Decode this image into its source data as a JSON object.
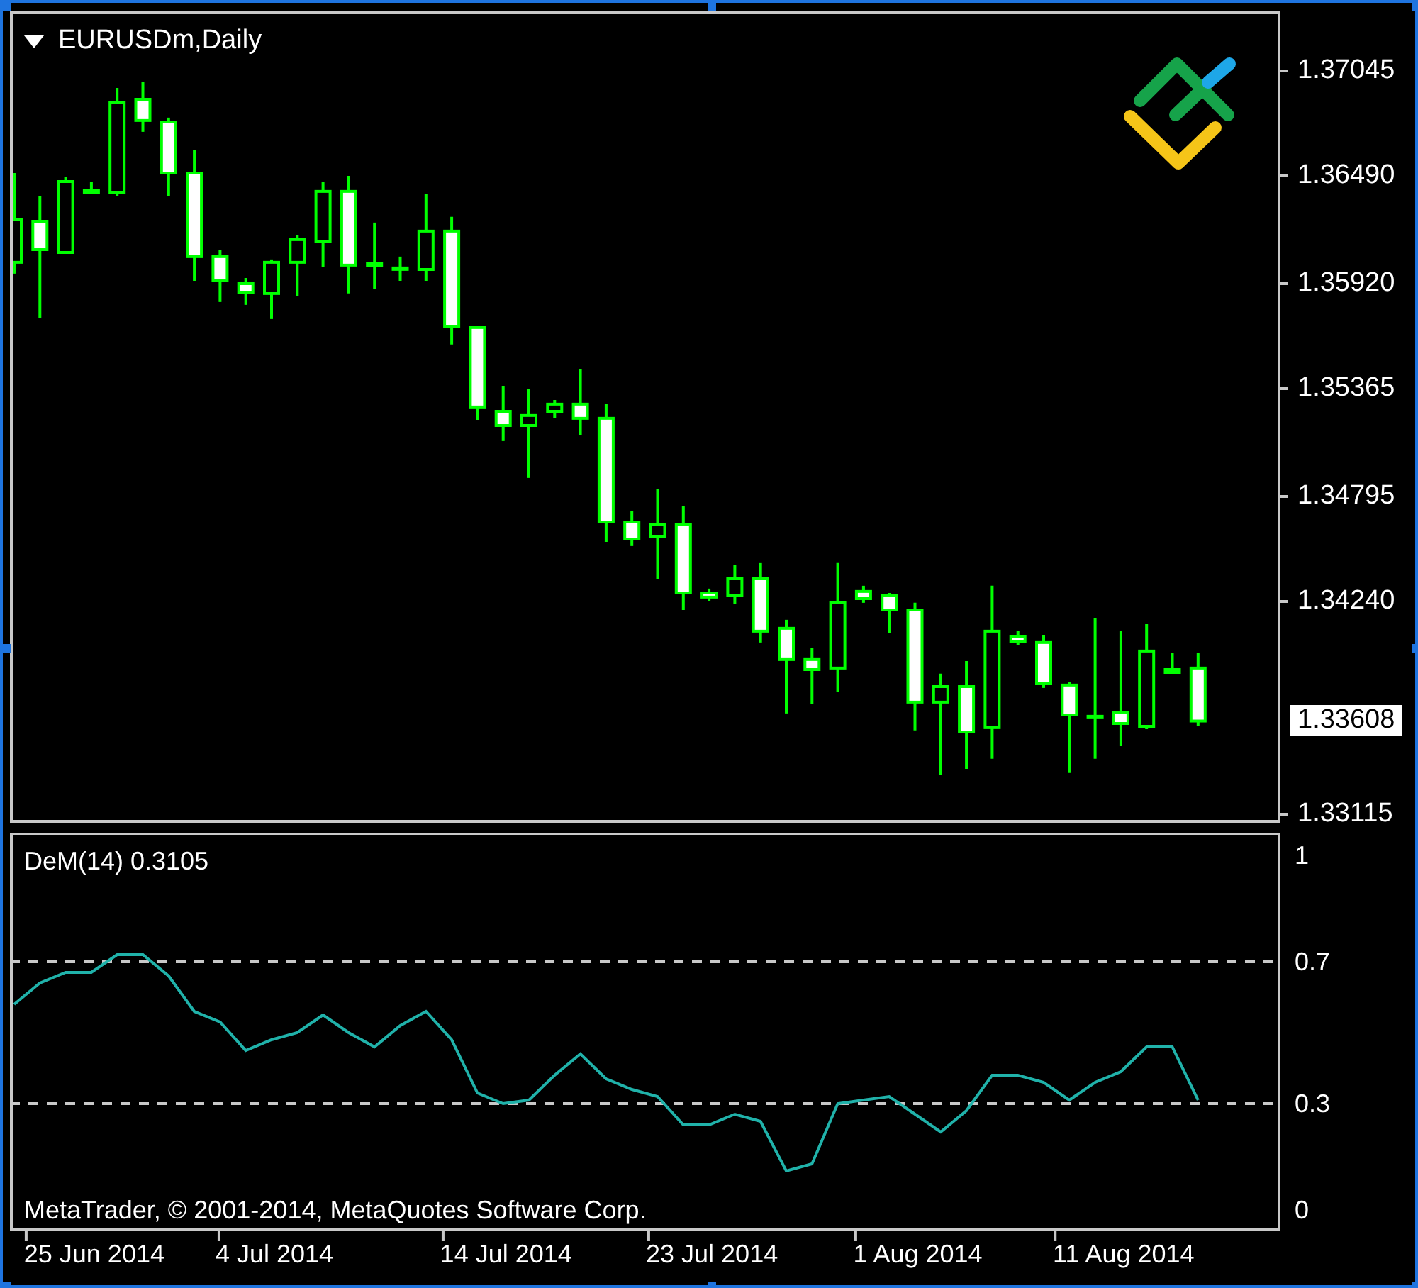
{
  "chart": {
    "symbol_title": "EURUSDm,Daily",
    "price_chart": {
      "chart_data": {
        "type": "candlestick",
        "categories": [
          null,
          null,
          null,
          null,
          null,
          null,
          null,
          null,
          null,
          null,
          null,
          null,
          null,
          null,
          null,
          null,
          null,
          null,
          null,
          null,
          null,
          null,
          null,
          null,
          null,
          null,
          null,
          null,
          null,
          null,
          null,
          null,
          null,
          null,
          null,
          null,
          null,
          null,
          null,
          null,
          null,
          null,
          null,
          null,
          null,
          null,
          null
        ],
        "ylim": [
          1.3307,
          1.3736
        ],
        "yticks": [
          {
            "value": 1.37045,
            "label": "1.37045"
          },
          {
            "value": 1.3649,
            "label": "1.36490"
          },
          {
            "value": 1.3592,
            "label": "1.35920"
          },
          {
            "value": 1.35365,
            "label": "1.35365"
          },
          {
            "value": 1.34795,
            "label": "1.34795"
          },
          {
            "value": 1.3424,
            "label": "1.34240"
          },
          {
            "value": 1.33115,
            "label": "1.33115"
          }
        ],
        "ohlc": [
          [
            1.36033,
            1.36505,
            1.35973,
            1.36258
          ],
          [
            1.3625,
            1.36385,
            1.3574,
            1.361
          ],
          [
            1.36085,
            1.36483,
            1.36085,
            1.3646
          ],
          [
            1.364,
            1.3646,
            1.36393,
            1.36415
          ],
          [
            1.364,
            1.36955,
            1.36385,
            1.3688
          ],
          [
            1.36895,
            1.36985,
            1.36723,
            1.36783
          ],
          [
            1.36775,
            1.36798,
            1.36385,
            1.36505
          ],
          [
            1.36505,
            1.36625,
            1.35935,
            1.36063
          ],
          [
            1.36063,
            1.361,
            1.35823,
            1.35935
          ],
          [
            1.3592,
            1.3595,
            1.35808,
            1.35875
          ],
          [
            1.35868,
            1.36048,
            1.35733,
            1.36033
          ],
          [
            1.36033,
            1.36175,
            1.35853,
            1.36153
          ],
          [
            1.36145,
            1.3646,
            1.3601,
            1.36408
          ],
          [
            1.36408,
            1.3649,
            1.35868,
            1.36018
          ],
          [
            1.36025,
            1.36243,
            1.3589,
            1.36025
          ],
          [
            1.36003,
            1.36063,
            1.35935,
            1.36003
          ],
          [
            1.35995,
            1.36393,
            1.35935,
            1.36198
          ],
          [
            1.36198,
            1.36273,
            1.35598,
            1.35695
          ],
          [
            1.35688,
            1.35695,
            1.352,
            1.35268
          ],
          [
            1.35245,
            1.3538,
            1.35088,
            1.3517
          ],
          [
            1.3517,
            1.35365,
            1.34893,
            1.35223
          ],
          [
            1.35245,
            1.35305,
            1.35208,
            1.35283
          ],
          [
            1.35283,
            1.3547,
            1.35118,
            1.35208
          ],
          [
            1.35208,
            1.35283,
            1.34555,
            1.3466
          ],
          [
            1.3466,
            1.3472,
            1.34533,
            1.3457
          ],
          [
            1.34585,
            1.34833,
            1.3436,
            1.34645
          ],
          [
            1.34645,
            1.34743,
            1.34195,
            1.34285
          ],
          [
            1.34285,
            1.34308,
            1.3424,
            1.34263
          ],
          [
            1.3427,
            1.34435,
            1.34225,
            1.3436
          ],
          [
            1.3436,
            1.34443,
            1.34023,
            1.34083
          ],
          [
            1.34098,
            1.34143,
            1.33648,
            1.33933
          ],
          [
            1.33933,
            1.33993,
            1.337,
            1.3388
          ],
          [
            1.33888,
            1.34443,
            1.3376,
            1.34233
          ],
          [
            1.34293,
            1.34323,
            1.34233,
            1.34255
          ],
          [
            1.3427,
            1.34285,
            1.34075,
            1.34195
          ],
          [
            1.34195,
            1.34233,
            1.33558,
            1.33708
          ],
          [
            1.33708,
            1.33858,
            1.33325,
            1.3379
          ],
          [
            1.3379,
            1.33925,
            1.33355,
            1.3355
          ],
          [
            1.33573,
            1.34323,
            1.33408,
            1.34083
          ],
          [
            1.34053,
            1.34083,
            1.34008,
            1.3403
          ],
          [
            1.34023,
            1.3406,
            1.33783,
            1.33805
          ],
          [
            1.33798,
            1.33813,
            1.33333,
            1.3364
          ],
          [
            1.33633,
            1.3415,
            1.33408,
            1.33633
          ],
          [
            1.33655,
            1.34083,
            1.33475,
            1.33595
          ],
          [
            1.3358,
            1.3412,
            1.33565,
            1.33978
          ],
          [
            1.33865,
            1.3397,
            1.33858,
            1.3388
          ],
          [
            1.33888,
            1.3397,
            1.3358,
            1.33608
          ]
        ]
      },
      "current_price": "1.33608"
    },
    "indicator": {
      "current_value": "0.3105",
      "chart_data": {
        "type": "line",
        "categories": [
          null,
          null,
          null,
          "25 Jun 2014",
          null,
          null,
          null,
          null,
          null,
          null,
          "4 Jul 2014",
          null,
          null,
          null,
          null,
          null,
          null,
          null,
          null,
          "14 Jul 2014",
          null,
          null,
          null,
          null,
          null,
          null,
          null,
          "23 Jul 2014",
          null,
          null,
          null,
          null,
          null,
          null,
          null,
          "1 Aug 2014",
          null,
          null,
          null,
          null,
          null,
          null,
          null,
          "11 Aug 2014",
          null,
          null,
          null
        ],
        "ylim": [
          -0.06,
          1.064
        ],
        "yticks": [
          {
            "value": 1,
            "label": "1"
          },
          {
            "value": 0.7,
            "label": "0.7"
          },
          {
            "value": 0.3,
            "label": "0.3"
          },
          {
            "value": 0,
            "label": "0"
          }
        ],
        "series": [
          {
            "name": "DeM(14)",
            "color": "#20b2aa",
            "values": [
              0.58,
              0.64,
              0.67,
              0.67,
              0.72,
              0.72,
              0.66,
              0.56,
              0.53,
              0.45,
              0.48,
              0.5,
              0.55,
              0.5,
              0.46,
              0.52,
              0.56,
              0.48,
              0.33,
              0.3,
              0.31,
              0.38,
              0.44,
              0.37,
              0.34,
              0.32,
              0.24,
              0.24,
              0.27,
              0.25,
              0.11,
              0.13,
              0.3,
              0.31,
              0.32,
              0.27,
              0.22,
              0.28,
              0.38,
              0.38,
              0.36,
              0.31,
              0.36,
              0.39,
              0.46,
              0.46,
              0.31
            ]
          }
        ]
      }
    },
    "copyright": "MetaTrader, © 2001-2014, MetaQuotes Software Corp."
  }
}
